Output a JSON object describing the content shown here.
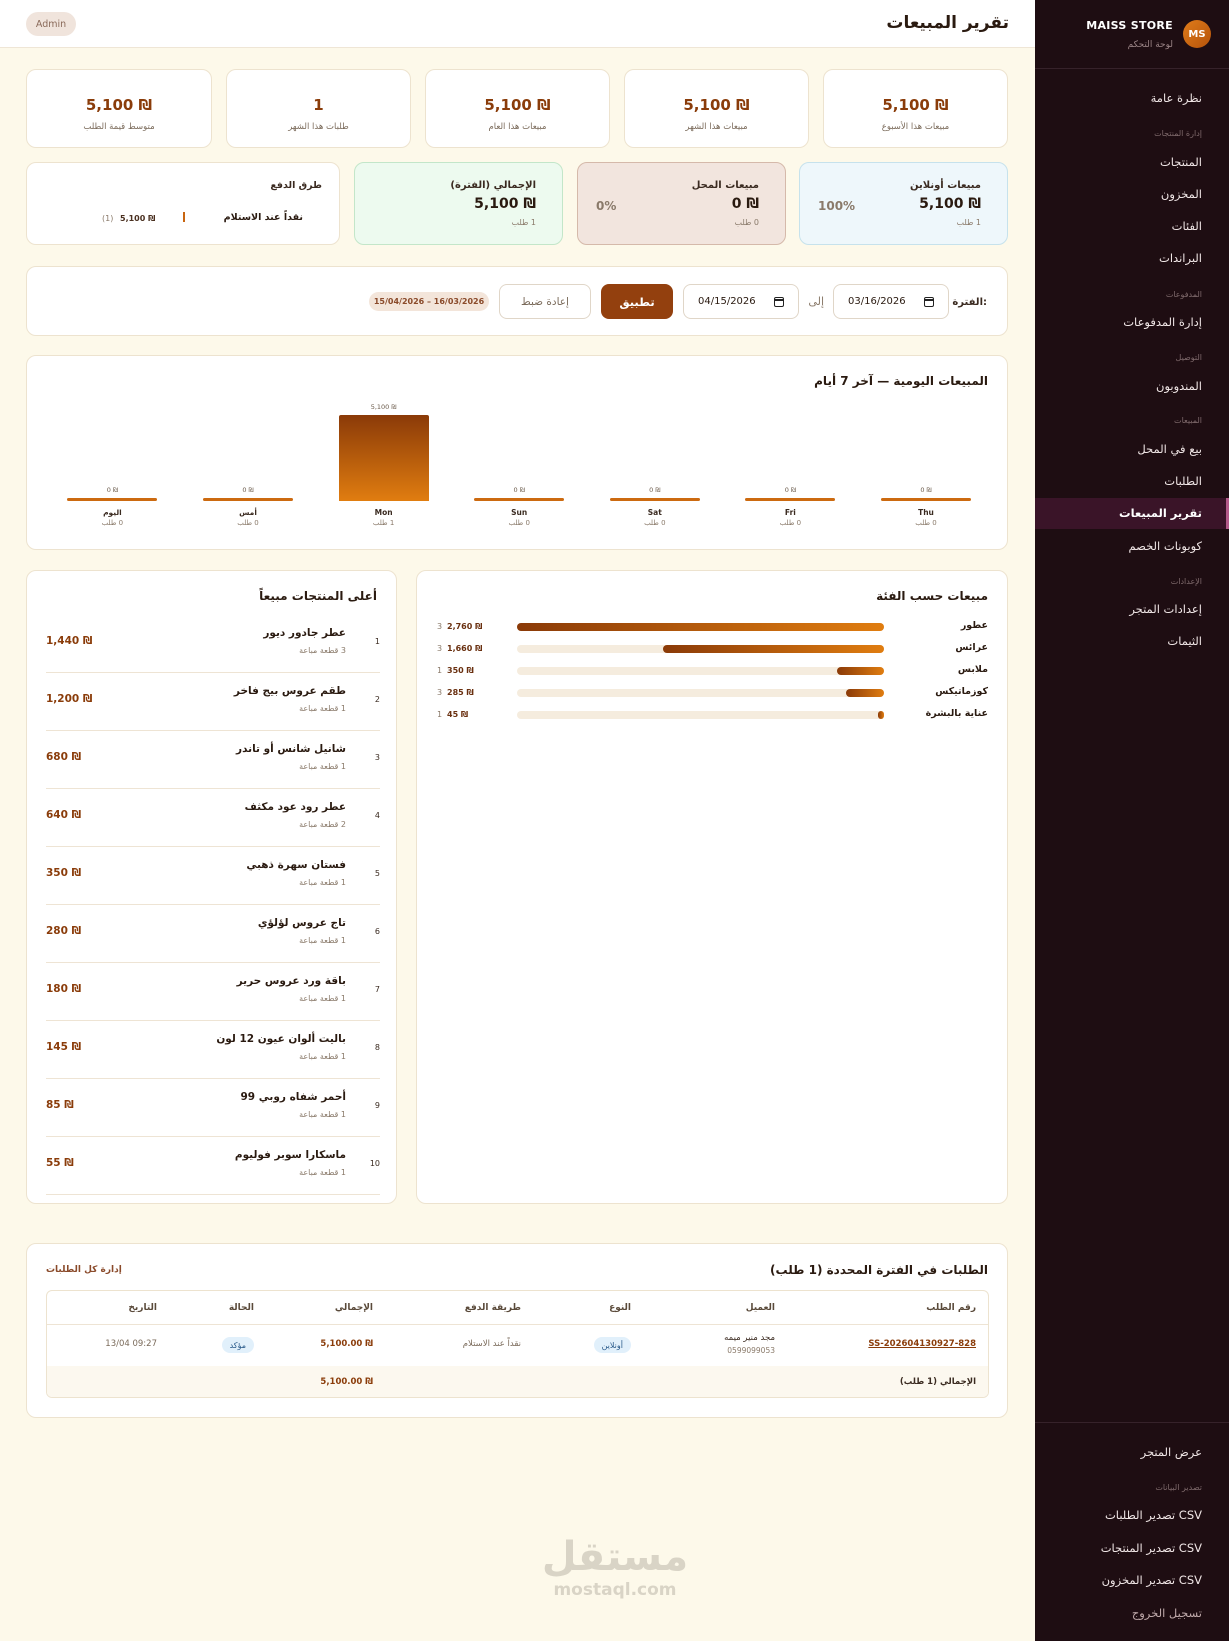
{
  "sidebar": {
    "avatar": "MS",
    "store_name": "MAISS STORE",
    "store_sub": "لوحة التحكم",
    "overview": "نظرة عامة",
    "group_products": "إدارة المنتجات",
    "products": "المنتجات",
    "inventory": "المخزون",
    "categories": "الفئات",
    "brands": "البراندات",
    "group_payments": "المدفوعات",
    "payments": "إدارة المدفوعات",
    "group_delivery": "التوصيل",
    "delegates": "المندوبون",
    "group_sales": "المبيعات",
    "pos": "بيع في المحل",
    "orders": "الطلبات",
    "sales_report": "تقرير المبيعات",
    "coupons": "كوبونات الخصم",
    "group_settings": "الإعدادات",
    "store_settings": "إعدادات المتجر",
    "themes": "الثيمات",
    "view_store": "عرض المتجر",
    "group_export": "تصدير البيانات",
    "export_orders": "تصدير الطلبات CSV",
    "export_products": "تصدير المنتجات CSV",
    "export_inventory": "تصدير المخزون CSV",
    "logout": "تسجيل الخروج"
  },
  "header": {
    "title": "تقرير المبيعات",
    "badge": "Admin"
  },
  "stats": [
    {
      "value": "5,100 ₪",
      "label": "مبيعات هذا الأسبوع"
    },
    {
      "value": "5,100 ₪",
      "label": "مبيعات هذا الشهر"
    },
    {
      "value": "5,100 ₪",
      "label": "مبيعات هذا العام"
    },
    {
      "value": "1",
      "label": "طلبات هذا الشهر"
    },
    {
      "value": "5,100 ₪",
      "label": "متوسط قيمة الطلب"
    }
  ],
  "channels": {
    "online": {
      "title": "مبيعات أونلاين",
      "value": "5,100 ₪",
      "sub": "1 طلب",
      "pct": "100%"
    },
    "store": {
      "title": "مبيعات المحل",
      "value": "0 ₪",
      "sub": "0 طلب",
      "pct": "0%"
    },
    "total": {
      "title": "الإجمالي (الفترة)",
      "value": "5,100 ₪",
      "sub": "1 طلب"
    }
  },
  "payment_methods": {
    "title": "طرق الدفع",
    "items": [
      {
        "name": "نقداً عند الاستلام",
        "amount": "5,100 ₪",
        "count": "(1)"
      }
    ]
  },
  "filter": {
    "label": "الفترة:",
    "from": "03/16/2026",
    "to_label": "إلى",
    "to": "04/15/2026",
    "apply": "تطبيق",
    "reset": "إعادة ضبط",
    "range": "15/04/2026 – 16/03/2026"
  },
  "daily": {
    "title": "المبيعات اليومية — آخر 7 أيام"
  },
  "chart_data": {
    "type": "bar",
    "title": "المبيعات اليومية — آخر 7 أيام",
    "categories": [
      "Thu",
      "Fri",
      "Sat",
      "Sun",
      "Mon",
      "أمس",
      "اليوم"
    ],
    "values": [
      0,
      0,
      0,
      0,
      5100,
      0,
      0
    ],
    "value_labels": [
      "0 ₪",
      "0 ₪",
      "0 ₪",
      "0 ₪",
      "5,100 ₪",
      "0 ₪",
      "0 ₪"
    ],
    "order_labels": [
      "0 طلب",
      "0 طلب",
      "0 طلب",
      "0 طلب",
      "1 طلب",
      "0 طلب",
      "0 طلب"
    ],
    "ylim": [
      0,
      5100
    ]
  },
  "categories": {
    "title": "مبيعات حسب الفئة",
    "items": [
      {
        "name": "عطور",
        "amount": "2,760 ₪",
        "count": "3",
        "value": 2760
      },
      {
        "name": "عرائس",
        "amount": "1,660 ₪",
        "count": "3",
        "value": 1660
      },
      {
        "name": "ملابس",
        "amount": "350 ₪",
        "count": "1",
        "value": 350
      },
      {
        "name": "كوزماتيكس",
        "amount": "285 ₪",
        "count": "3",
        "value": 285
      },
      {
        "name": "عناية بالبشرة",
        "amount": "45 ₪",
        "count": "1",
        "value": 45
      }
    ]
  },
  "top_products": {
    "title": "أعلى المنتجات مبيعاً",
    "items": [
      {
        "rank": "1",
        "name": "عطر جادور ديور",
        "sub": "3 قطعة مباعة",
        "price": "1,440 ₪"
      },
      {
        "rank": "2",
        "name": "طقم عروس بيج فاخر",
        "sub": "1 قطعة مباعة",
        "price": "1,200 ₪"
      },
      {
        "rank": "3",
        "name": "شانيل شانس أو تاندر",
        "sub": "1 قطعة مباعة",
        "price": "680 ₪"
      },
      {
        "rank": "4",
        "name": "عطر رود عود مكثف",
        "sub": "2 قطعة مباعة",
        "price": "640 ₪"
      },
      {
        "rank": "5",
        "name": "فستان سهرة ذهبي",
        "sub": "1 قطعة مباعة",
        "price": "350 ₪"
      },
      {
        "rank": "6",
        "name": "تاج عروس لؤلؤي",
        "sub": "1 قطعة مباعة",
        "price": "280 ₪"
      },
      {
        "rank": "7",
        "name": "باقة ورد عروس حرير",
        "sub": "1 قطعة مباعة",
        "price": "180 ₪"
      },
      {
        "rank": "8",
        "name": "باليت ألوان عيون 12 لون",
        "sub": "1 قطعة مباعة",
        "price": "145 ₪"
      },
      {
        "rank": "9",
        "name": "أحمر شفاه روبي 99",
        "sub": "1 قطعة مباعة",
        "price": "85 ₪"
      },
      {
        "rank": "10",
        "name": "ماسكارا سوبر فوليوم",
        "sub": "1 قطعة مباعة",
        "price": "55 ₪"
      }
    ]
  },
  "orders": {
    "title": "الطلبات في الفترة المحددة (1 طلب)",
    "manage_link": "إدارة كل الطلبات",
    "columns": {
      "order_no": "رقم الطلب",
      "customer": "العميل",
      "type": "النوع",
      "payment": "طريقة الدفع",
      "total": "الإجمالي",
      "status": "الحالة",
      "date": "التاريخ"
    },
    "rows": [
      {
        "order_no": "SS-202604130927-828",
        "customer": "مجد منير ميمه",
        "phone": "0599099053",
        "type": "أونلاين",
        "payment": "نقداً عند الاستلام",
        "total": "5,100.00 ₪",
        "status": "مؤكد",
        "date": "13/04 09:27"
      }
    ],
    "footer_label": "الإجمالي (1 طلب)",
    "footer_total": "5,100.00 ₪"
  },
  "watermark": {
    "ar": "مستقل",
    "en": "mostaql.com"
  }
}
